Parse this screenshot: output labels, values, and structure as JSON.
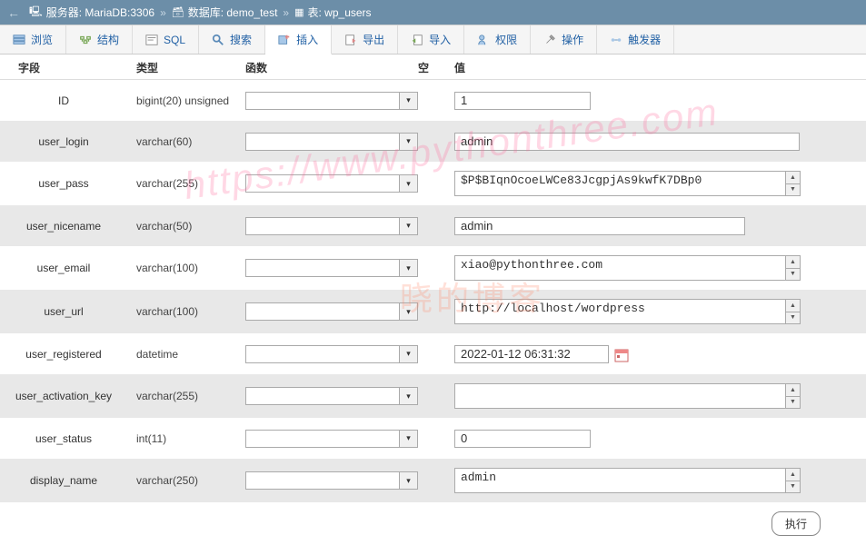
{
  "breadcrumb": {
    "server": "服务器: MariaDB:3306",
    "database": "数据库: demo_test",
    "table": "表: wp_users"
  },
  "tabs": {
    "browse": "浏览",
    "structure": "结构",
    "sql": "SQL",
    "search": "搜索",
    "insert": "插入",
    "export": "导出",
    "import": "导入",
    "privileges": "权限",
    "operations": "操作",
    "triggers": "触发器"
  },
  "headers": {
    "field": "字段",
    "type": "类型",
    "function": "函数",
    "null": "空",
    "value": "值"
  },
  "rows": [
    {
      "field": "ID",
      "type": "bigint(20) unsigned",
      "value": "1",
      "input": "short"
    },
    {
      "field": "user_login",
      "type": "varchar(60)",
      "value": "admin",
      "input": "text"
    },
    {
      "field": "user_pass",
      "type": "varchar(255)",
      "value": "$P$BIqnOcoeLWCe83JcgpjAs9kwfK7DBp0",
      "input": "textarea"
    },
    {
      "field": "user_nicename",
      "type": "varchar(50)",
      "value": "admin",
      "input": "textmed"
    },
    {
      "field": "user_email",
      "type": "varchar(100)",
      "value": "xiao@pythonthree.com",
      "input": "textarea"
    },
    {
      "field": "user_url",
      "type": "varchar(100)",
      "value": "http://localhost/wordpress",
      "input": "textarea"
    },
    {
      "field": "user_registered",
      "type": "datetime",
      "value": "2022-01-12 06:31:32",
      "input": "date"
    },
    {
      "field": "user_activation_key",
      "type": "varchar(255)",
      "value": "",
      "input": "textarea"
    },
    {
      "field": "user_status",
      "type": "int(11)",
      "value": "0",
      "input": "short"
    },
    {
      "field": "display_name",
      "type": "varchar(250)",
      "value": "admin",
      "input": "textarea"
    }
  ],
  "buttons": {
    "execute": "执行"
  },
  "watermark": {
    "url": "https://www.pythonthree.com",
    "text": "晓的博客"
  }
}
